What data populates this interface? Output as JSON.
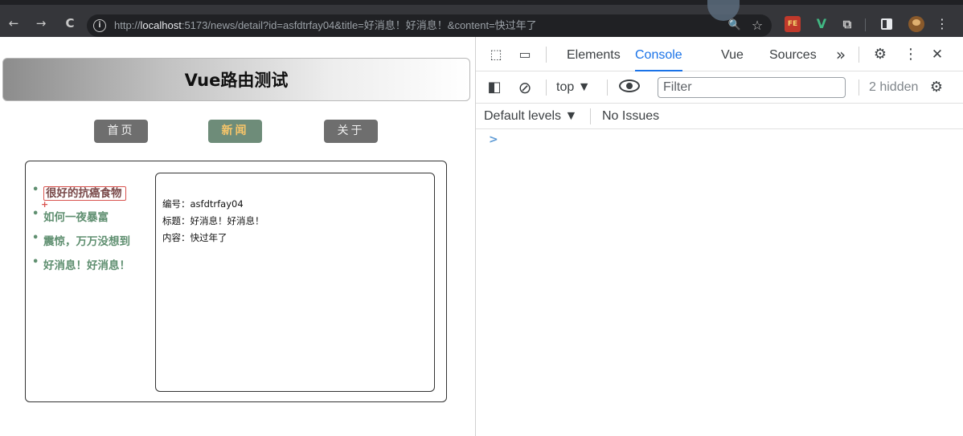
{
  "browser": {
    "back_icon": "←",
    "forward_icon": "→",
    "reload_icon": "C",
    "info_icon": "i",
    "url_prefix": "http://",
    "url_host": "localhost",
    "url_rest": ":5173/news/detail?id=asfdtrfay04&title=好消息！好消息！&content=快过年了",
    "zoom_icon": "🔍",
    "star_icon": "☆",
    "ext_fe_label": "FE",
    "ext_vue_label": "V",
    "ext_puzzle_label": "⧉",
    "menu_icon": "⋮"
  },
  "page": {
    "title": "Vue路由测试",
    "nav": [
      {
        "label": "首页"
      },
      {
        "label": "新闻"
      },
      {
        "label": "关于"
      }
    ],
    "news_list": [
      {
        "label": "很好的抗癌食物"
      },
      {
        "label": "如何一夜暴富"
      },
      {
        "label": "震惊，万万没想到"
      },
      {
        "label": "好消息！好消息！"
      }
    ],
    "cursor_mark": "+",
    "detail": {
      "id_label": "编号：",
      "id_value": "asfdtrfay04",
      "title_label": "标题：",
      "title_value": "好消息！好消息！",
      "content_label": "内容：",
      "content_value": "快过年了"
    }
  },
  "devtools": {
    "inspect_icon": "⬚",
    "device_icon": "▭",
    "tabs": [
      {
        "label": "Elements"
      },
      {
        "label": "Console"
      },
      {
        "label": "Vue"
      },
      {
        "label": "Sources"
      }
    ],
    "more_tabs_icon": "»",
    "settings_icon": "⚙",
    "kebab_icon": "⋮",
    "close_icon": "✕",
    "sidebar_icon": "◧",
    "clear_icon": "⊘",
    "context_label": "top ▼",
    "filter_placeholder": "Filter",
    "hidden_label": "2 hidden",
    "levels_label": "Default levels ▼",
    "issues_label": "No Issues",
    "prompt_icon": ">"
  },
  "colors": {
    "active_nav_bg": "#6e8c79",
    "active_nav_text": "#f6c56a",
    "news_link": "#5f8f70",
    "devtools_accent": "#1a73e8"
  }
}
